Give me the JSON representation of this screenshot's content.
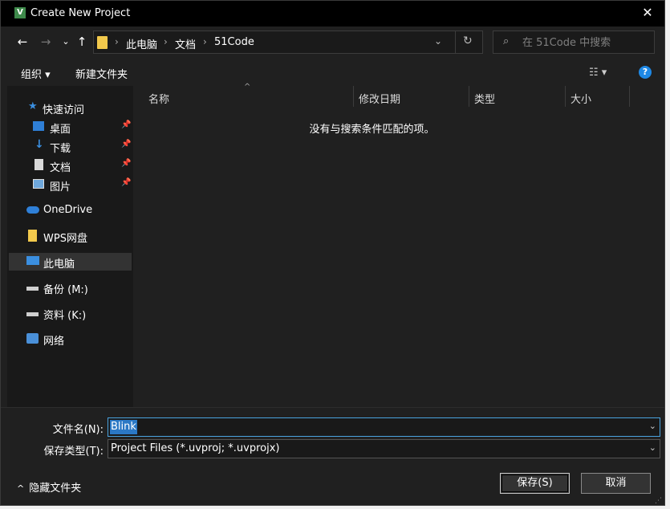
{
  "window": {
    "title": "Create New Project",
    "app_icon": "keil-uvision-icon",
    "close": "✕"
  },
  "nav": {
    "back": "←",
    "forward": "→",
    "recent": "⌄",
    "up": "↑",
    "breadcrumbs": [
      "此电脑",
      "文档",
      "51Code"
    ],
    "separator": "›",
    "search_placeholder": "在 51Code 中搜索"
  },
  "toolbar": {
    "organize": "组织 ▾",
    "new_folder": "新建文件夹",
    "view": "☷ ▾",
    "help": "?"
  },
  "sidebar": {
    "quick_access": "快速访问",
    "pinned": [
      {
        "label": "桌面",
        "icon": "desktop-icon"
      },
      {
        "label": "下载",
        "icon": "download-icon"
      },
      {
        "label": "文档",
        "icon": "documents-icon"
      },
      {
        "label": "图片",
        "icon": "pictures-icon"
      }
    ],
    "onedrive": "OneDrive",
    "wps": "WPS网盘",
    "this_pc": "此电脑",
    "drive_m": "备份 (M:)",
    "drive_k": "资料 (K:)",
    "network": "网络"
  },
  "columns": {
    "name": "名称",
    "modified": "修改日期",
    "type": "类型",
    "size": "大小"
  },
  "empty_message": "没有与搜索条件匹配的项。",
  "form": {
    "filename_label": "文件名(N):",
    "filename_value": "Blink",
    "filetype_label": "保存类型(T):",
    "filetype_value": "Project Files (*.uvproj; *.uvprojx)"
  },
  "footer": {
    "hide_folders": "隐藏文件夹",
    "save": "保存(S)",
    "cancel": "取消"
  },
  "colors": {
    "accent": "#1e88e5",
    "selection": "#2b78c5",
    "folder": "#f2c94c"
  }
}
